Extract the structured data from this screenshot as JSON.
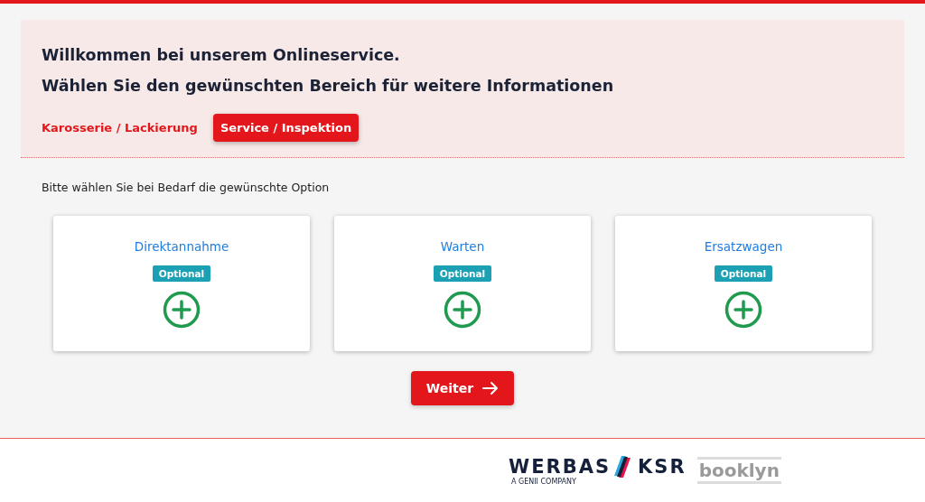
{
  "header": {
    "title_lines": [
      "Willkommen bei unserem Onlineservice.",
      "Wählen Sie den gewünschten Bereich für weitere Informationen"
    ]
  },
  "tabs": [
    {
      "label": "Karosserie / Lackierung",
      "selected": false
    },
    {
      "label": "Service / Inspektion",
      "selected": true
    }
  ],
  "instruction": "Bitte wählen Sie bei Bedarf die gewünschte Option",
  "options": [
    {
      "title": "Direktannahme",
      "badge": "Optional"
    },
    {
      "title": "Warten",
      "badge": "Optional"
    },
    {
      "title": "Ersatzwagen",
      "badge": "Optional"
    }
  ],
  "next_button": "Weiter",
  "footer": {
    "brand_left": "WERBAS",
    "brand_right": "KSR",
    "tagline": "A GENII COMPANY",
    "partner": "booklyn"
  }
}
